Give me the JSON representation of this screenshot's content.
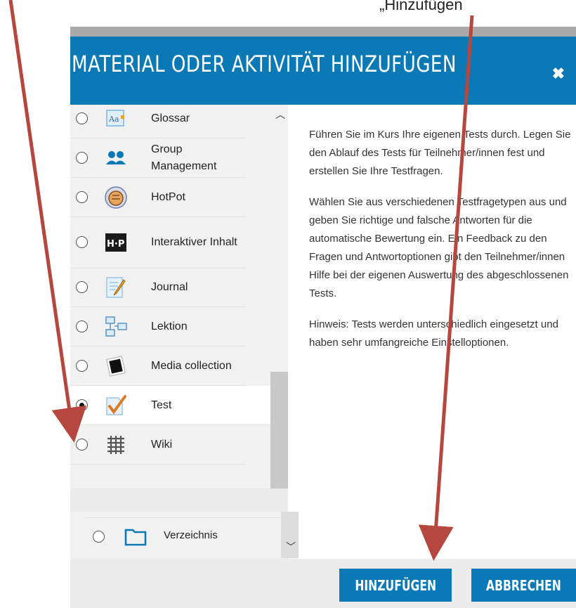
{
  "top_text": "„Hinzufügen",
  "dialog": {
    "title": "MATERIAL ODER AKTIVITÄT HINZUFÜGEN",
    "close_glyph": "✖"
  },
  "items": [
    {
      "label": "Glossar",
      "icon": "glossary-icon",
      "selected": false
    },
    {
      "label": "Group Management",
      "icon": "group-icon",
      "selected": false
    },
    {
      "label": "HotPot",
      "icon": "hotpot-icon",
      "selected": false
    },
    {
      "label": "Interaktiver Inhalt",
      "icon": "h5p-icon",
      "selected": false
    },
    {
      "label": "Journal",
      "icon": "journal-icon",
      "selected": false
    },
    {
      "label": "Lektion",
      "icon": "lesson-icon",
      "selected": false
    },
    {
      "label": "Media collection",
      "icon": "media-collection-icon",
      "selected": false
    },
    {
      "label": "Test",
      "icon": "test-icon",
      "selected": true
    },
    {
      "label": "Wiki",
      "icon": "wiki-icon",
      "selected": false
    }
  ],
  "lower_item": {
    "label": "Verzeichnis",
    "icon": "folder-icon"
  },
  "description": {
    "p1": "Führen Sie im Kurs Ihre eigenen Tests durch. Legen Sie den Ablauf des Tests für Teilnehmer/innen fest und erstellen Sie Ihre Testfragen.",
    "p2": "Wählen Sie aus verschiedenen Testfragetypen aus und geben Sie richtige und falsche Antworten für die automatische Bewertung ein. Ein Feedback zu den Fragen und Antwortoptionen gibt den Teilnehmer/innen Hilfe bei der eigenen Auswertung des abgeschlossenen Tests.",
    "p3": "Hinweis: Tests werden unterschiedlich eingesetzt und haben sehr umfangreiche Einstelloptionen."
  },
  "buttons": {
    "add": "HINZUFÜGEN",
    "cancel": "ABBRECHEN"
  },
  "colors": {
    "accent": "#0b79b6",
    "arrow": "#b5473f"
  }
}
